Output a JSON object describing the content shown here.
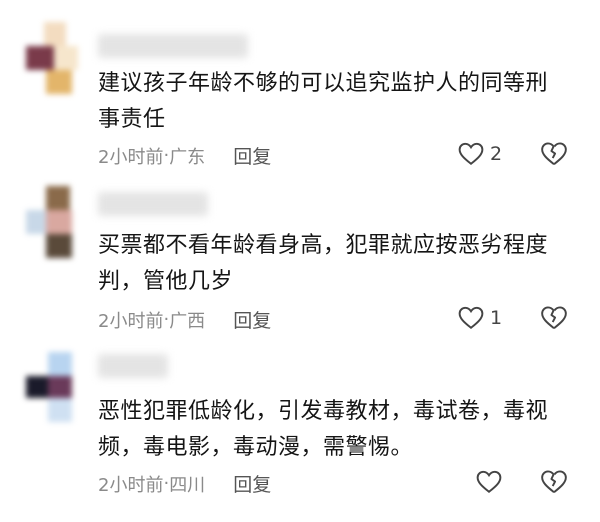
{
  "comments": [
    {
      "text": "建议孩子年龄不够的可以追究监护人的同等刑事责任",
      "time": "2小时前",
      "sep": " · ",
      "location": "广东",
      "reply_label": "回复",
      "like_count": "2",
      "avatar_colors": [
        "#f2d6b8",
        "#7a3a4a",
        "#e8c07a"
      ]
    },
    {
      "text": "买票都不看年龄看身高，犯罪就应按恶劣程度判，管他几岁",
      "time": "2小时前",
      "sep": " · ",
      "location": "广西",
      "reply_label": "回复",
      "like_count": "1",
      "avatar_colors": [
        "#8a6a4a",
        "#d9b0a8",
        "#5a4a3a"
      ]
    },
    {
      "text": "恶性犯罪低龄化，引发毒教材，毒试卷，毒视频，毒电影，毒动漫，需警惕。",
      "time": "2小时前",
      "sep": " · ",
      "location": "四川",
      "reply_label": "回复",
      "like_count": "",
      "avatar_colors": [
        "#a9c8e8",
        "#5a3a5a",
        "#1a1a2a"
      ]
    }
  ]
}
